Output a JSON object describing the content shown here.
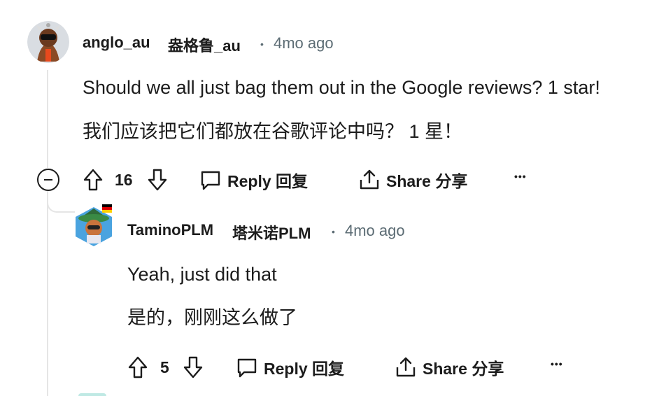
{
  "comment1": {
    "username": "anglo_au",
    "username_cn": "盎格鲁_au",
    "separator": "•",
    "time": "4mo ago",
    "text_en": "Should we all just bag them out in the Google reviews? 1 star!",
    "text_cn": "我们应该把它们都放在谷歌评论中吗？ 1 星！",
    "votes": "16",
    "reply_label": "Reply 回复",
    "share_label": "Share 分享",
    "more": "•••"
  },
  "comment2": {
    "username": "TaminoPLM",
    "username_cn": "塔米诺PLM",
    "separator": "•",
    "time": "4mo ago",
    "text_en": "Yeah, just did that",
    "text_cn": "是的，刚刚这么做了",
    "votes": "5",
    "reply_label": "Reply 回复",
    "share_label": "Share 分享",
    "more": "•••"
  },
  "colors": {
    "text": "#1c1c1c",
    "meta": "#5c6c74",
    "thread_line": "#e5e5e5"
  },
  "icons": [
    "upvote-icon",
    "downvote-icon",
    "comment-icon",
    "share-icon",
    "collapse-icon",
    "more-icon"
  ]
}
